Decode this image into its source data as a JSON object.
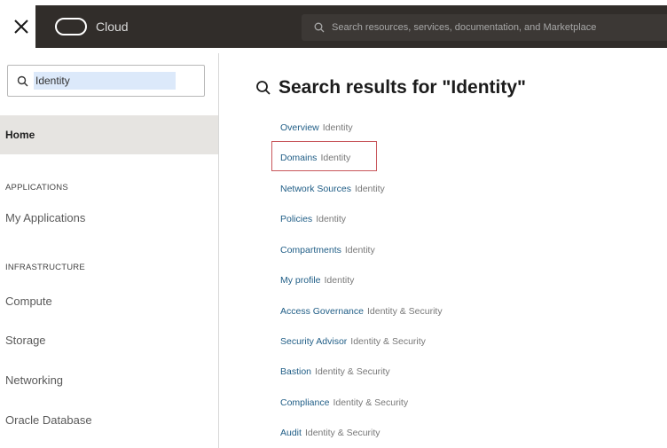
{
  "topbar": {
    "brand_label": "Cloud",
    "search_placeholder": "Search resources, services, documentation, and Marketplace"
  },
  "sidebar": {
    "search_value": "Identity",
    "home_label": "Home",
    "applications_heading": "APPLICATIONS",
    "my_applications_label": "My Applications",
    "infrastructure_heading": "INFRASTRUCTURE",
    "items": [
      {
        "label": "Compute"
      },
      {
        "label": "Storage"
      },
      {
        "label": "Networking"
      },
      {
        "label": "Oracle Database"
      }
    ]
  },
  "results": {
    "heading": "Search results for \"Identity\"",
    "items": [
      {
        "name": "Overview",
        "service": "Identity"
      },
      {
        "name": "Domains",
        "service": "Identity",
        "highlighted": true
      },
      {
        "name": "Network Sources",
        "service": "Identity"
      },
      {
        "name": "Policies",
        "service": "Identity"
      },
      {
        "name": "Compartments",
        "service": "Identity"
      },
      {
        "name": "My profile",
        "service": "Identity"
      },
      {
        "name": "Access Governance",
        "service": "Identity & Security"
      },
      {
        "name": "Security Advisor",
        "service": "Identity & Security"
      },
      {
        "name": "Bastion",
        "service": "Identity & Security"
      },
      {
        "name": "Compliance",
        "service": "Identity & Security"
      },
      {
        "name": "Audit",
        "service": "Identity & Security"
      }
    ]
  },
  "colors": {
    "brand_bar": "#312d2a",
    "link": "#1f5d86",
    "highlight": "#c8565b"
  }
}
